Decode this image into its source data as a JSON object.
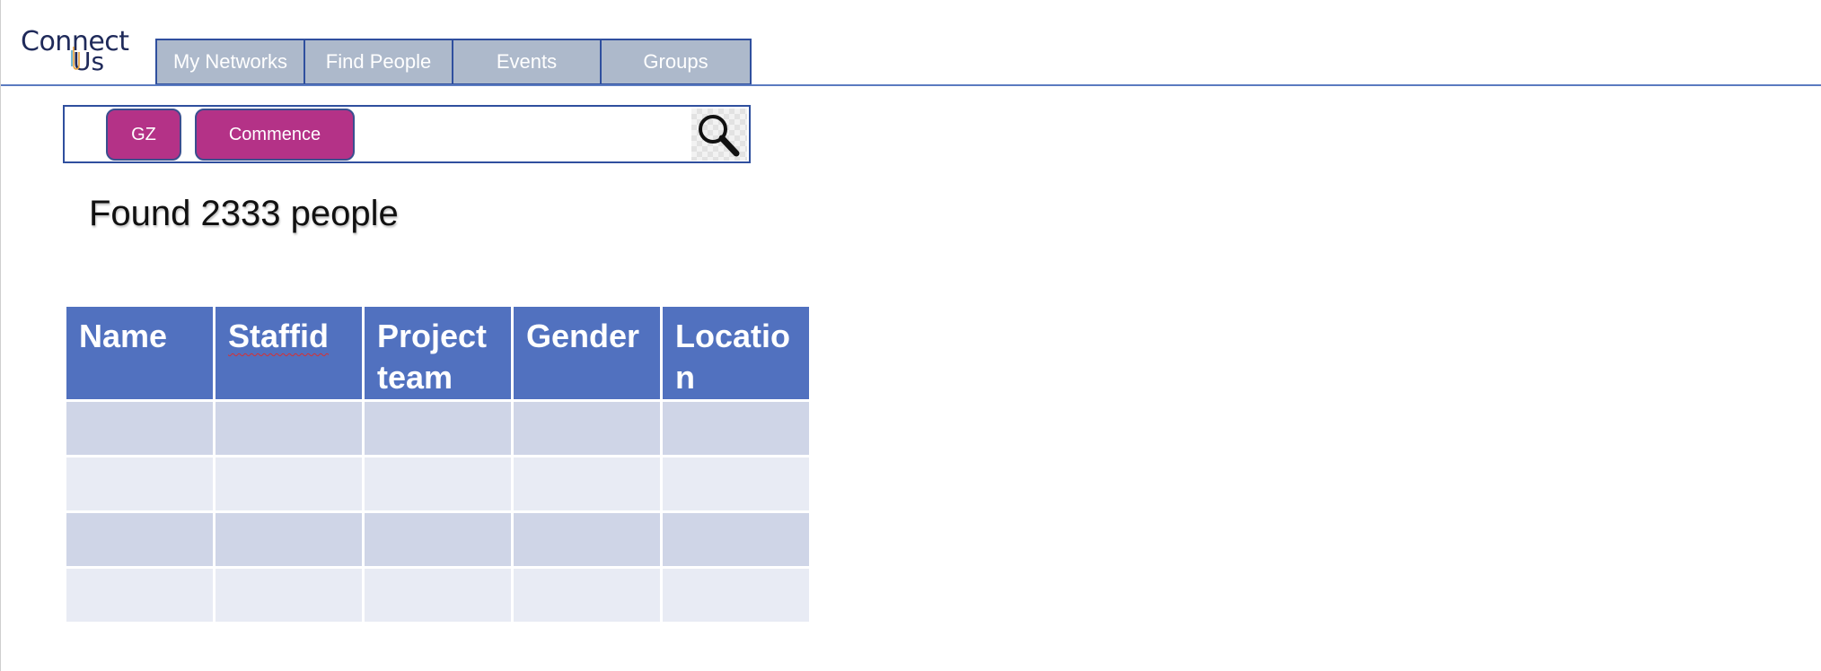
{
  "logo": {
    "line1": "Connect",
    "line2": "Us"
  },
  "nav": {
    "tabs": [
      "My Networks",
      "Find People",
      "Events",
      "Groups"
    ]
  },
  "search": {
    "chips": [
      "GZ",
      "Commence"
    ],
    "button_icon": "search-icon"
  },
  "results": {
    "found_text": "Found 2333 people"
  },
  "table": {
    "headers": [
      "Name",
      "Staffid",
      "Project team",
      "Gender",
      "Locatio n"
    ],
    "rows": [
      [
        "",
        "",
        "",
        "",
        ""
      ],
      [
        "",
        "",
        "",
        "",
        ""
      ],
      [
        "",
        "",
        "",
        "",
        ""
      ],
      [
        "",
        "",
        "",
        "",
        ""
      ]
    ]
  },
  "colors": {
    "nav_tab_bg": "#adb9cb",
    "nav_border": "#2f4f9e",
    "chip_bg": "#b43287",
    "table_header_bg": "#5171bf",
    "row_odd_bg": "#cfd5e7",
    "row_even_bg": "#e8ebf4"
  }
}
